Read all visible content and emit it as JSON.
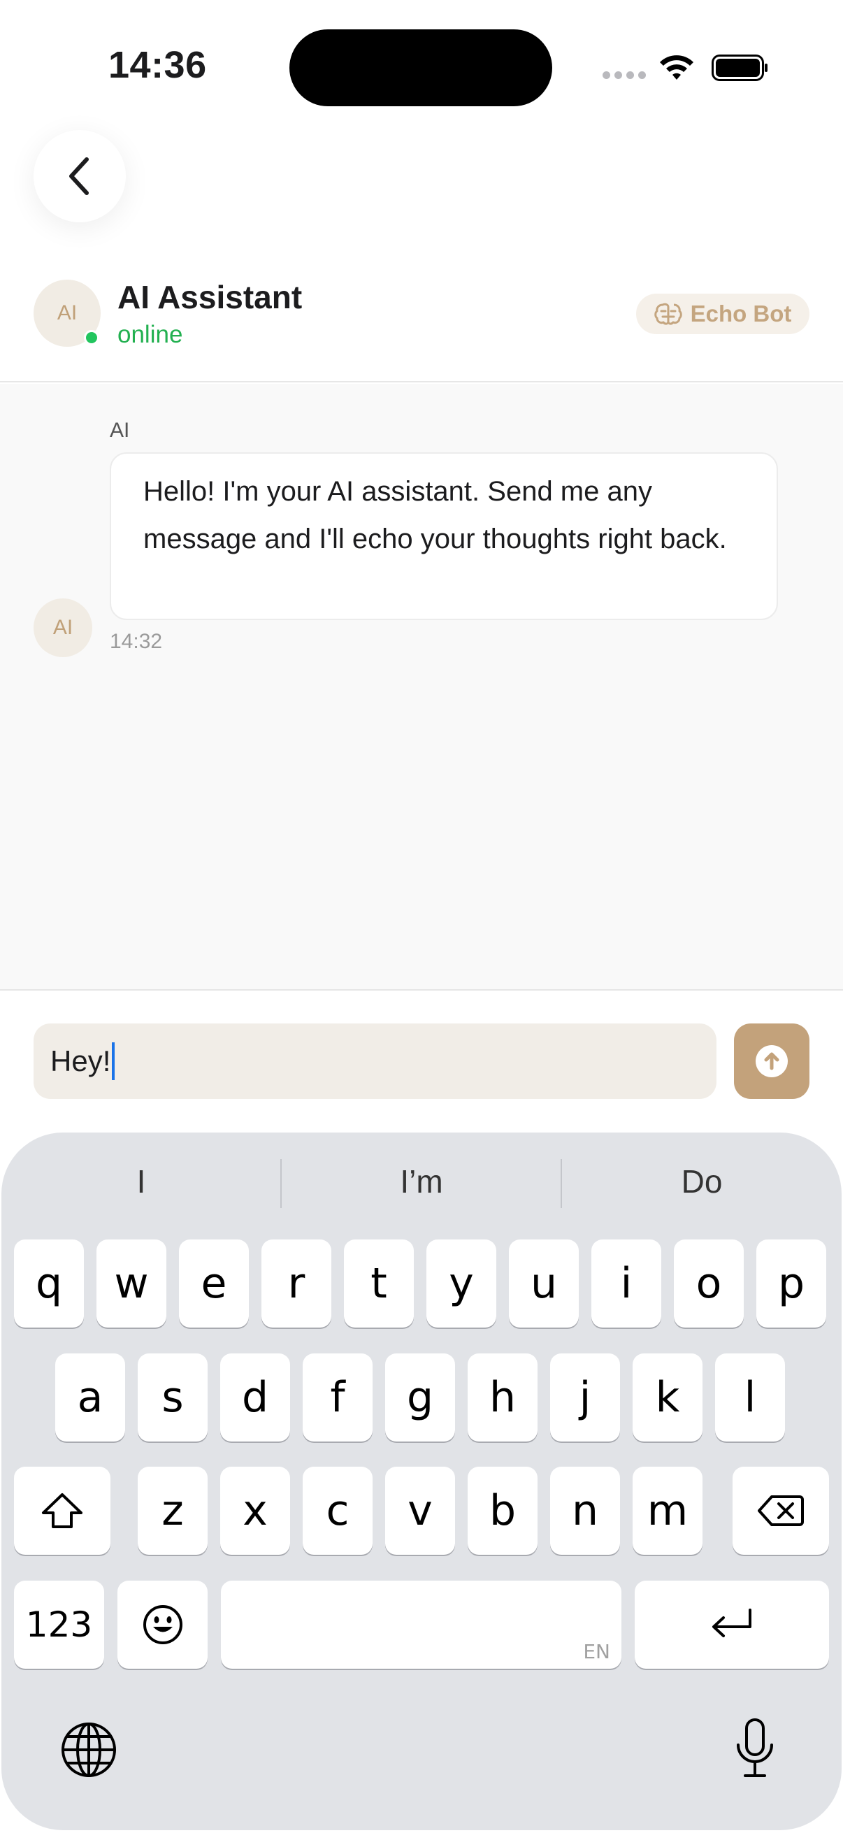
{
  "status_bar": {
    "time": "14:36"
  },
  "header": {
    "avatar_initials": "AI",
    "name": "AI Assistant",
    "status": "online",
    "badge_label": "Echo Bot"
  },
  "messages": [
    {
      "sender": "AI",
      "avatar_initials": "AI",
      "text": "Hello! I'm your AI assistant. Send me any message and I'll echo your thoughts right back.",
      "time": "14:32"
    }
  ],
  "composer": {
    "value": "Hey!"
  },
  "keyboard": {
    "suggestions": [
      "I",
      "I’m",
      "Do"
    ],
    "row1": [
      "q",
      "w",
      "e",
      "r",
      "t",
      "y",
      "u",
      "i",
      "o",
      "p"
    ],
    "row2": [
      "a",
      "s",
      "d",
      "f",
      "g",
      "h",
      "j",
      "k",
      "l"
    ],
    "row3": [
      "z",
      "x",
      "c",
      "v",
      "b",
      "n",
      "m"
    ],
    "numbers_label": "123",
    "language_label": "EN"
  },
  "colors": {
    "accent": "#c3a27b",
    "online": "#22c55e",
    "caret": "#1a73e8",
    "keyboard_bg": "#e1e3e7"
  },
  "icons": [
    "back-chevron-icon",
    "wifi-icon",
    "battery-icon",
    "brain-icon",
    "send-arrow-icon",
    "shift-icon",
    "backspace-icon",
    "emoji-icon",
    "return-icon",
    "globe-icon",
    "microphone-icon"
  ]
}
